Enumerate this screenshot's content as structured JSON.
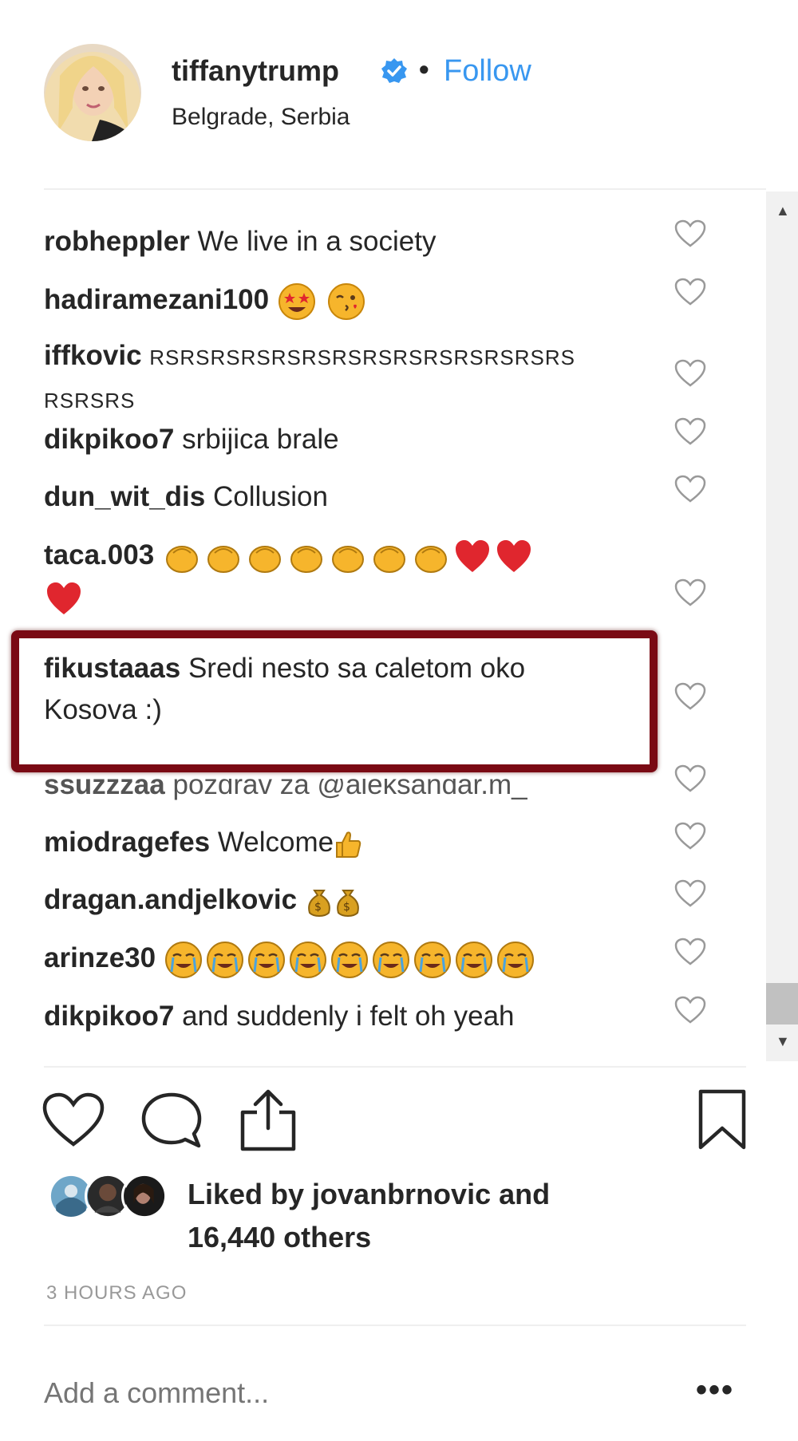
{
  "post_header": {
    "username": "tiffanytrump",
    "separator": "•",
    "follow_label": "Follow",
    "location": "Belgrade, Serbia",
    "follow_color": "#3897f0"
  },
  "comments": [
    {
      "user": "robheppler",
      "text": "We live in a society"
    },
    {
      "user": "hadiramezani100",
      "text": ""
    },
    {
      "user": "iffkovic",
      "text": "RSRSRSRSRSRSRSRSRSRSRSRSRSRS",
      "text2": "RSRSRS"
    },
    {
      "user": "dikpikoo7",
      "text": "srbijica brale"
    },
    {
      "user": "dun_wit_dis",
      "text": "Collusion"
    },
    {
      "user": "taca.003",
      "text": ""
    },
    {
      "user": "fikustaaas",
      "text": "Sredi nesto sa caletom oko",
      "text2": "Kosova :)"
    },
    {
      "user": "ssuzzzaa",
      "text": "pozdrav za @aleksandar.m_"
    },
    {
      "user": "miodragefes",
      "text": "Welcome"
    },
    {
      "user": "dragan.andjelkovic",
      "text": ""
    },
    {
      "user": "arinze30",
      "text": ""
    },
    {
      "user": "dikpikoo7",
      "text": "and suddenly i felt oh yeah"
    }
  ],
  "likes": {
    "line1": "Liked by jovanbrnovic and",
    "line2": "16,440 others"
  },
  "timestamp": "3 HOURS AGO",
  "add_comment": {
    "placeholder": "Add a comment...",
    "more_label": "•••"
  },
  "colors": {
    "highlight_border": "#7a0a14",
    "verified_badge": "#3897f0"
  },
  "icons": {
    "like": "heart-icon",
    "comment": "comment-bubble-icon",
    "share": "share-icon",
    "save": "bookmark-icon"
  }
}
